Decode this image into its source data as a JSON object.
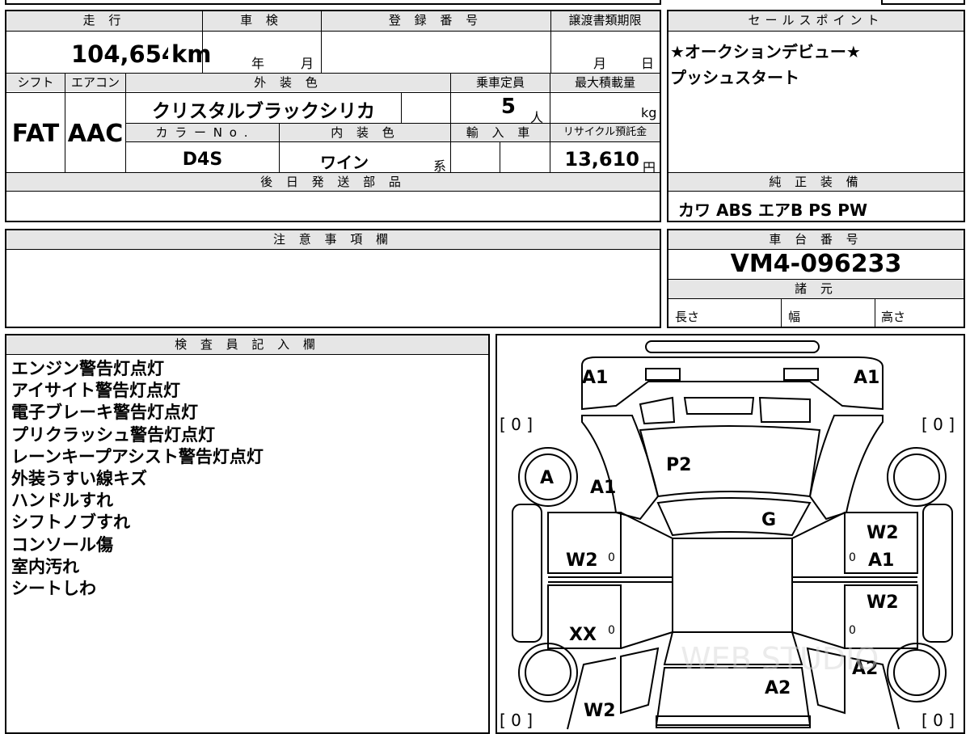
{
  "main": {
    "mileage": {
      "label": "走 行",
      "value": "104,654",
      "unit": "km"
    },
    "shaken": {
      "label": "車 検",
      "year_unit": "年",
      "month_unit": "月"
    },
    "registration": {
      "label": "登 録 番 号",
      "value": ""
    },
    "transfer_deadline": {
      "label": "譲渡書類期限",
      "month_unit": "月",
      "day_unit": "日"
    },
    "shift": {
      "label": "シフト",
      "value": "FAT"
    },
    "aircon": {
      "label": "エアコン",
      "value": "AAC"
    },
    "exterior_color": {
      "label": "外 装 色",
      "value": "クリスタルブラックシリカ"
    },
    "capacity": {
      "label": "乗車定員",
      "value": "5",
      "unit": "人"
    },
    "max_load": {
      "label": "最大積載量",
      "value": "",
      "unit": "kg"
    },
    "color_no": {
      "label": "カ ラ ー N o .",
      "value": "D4S"
    },
    "interior_color": {
      "label": "内 装 色",
      "value": "ワイン",
      "unit": "系"
    },
    "import": {
      "label": "輸 入 車"
    },
    "recycle": {
      "label": "リサイクル預託金",
      "value": "13,610",
      "unit": "円"
    },
    "parts_later": {
      "label": "後 日 発 送 部 品"
    }
  },
  "sales_point": {
    "label": "セールスポイント",
    "lines": [
      "★オークションデビュー★",
      "プッシュスタート"
    ]
  },
  "equipment": {
    "label": "純 正 装 備",
    "value": "カワ ABS エアB PS PW"
  },
  "notes": {
    "label": "注 意 事 項 欄"
  },
  "chassis": {
    "label": "車 台 番 号",
    "value": "VM4-096233"
  },
  "specs": {
    "label": "諸 元",
    "length": "長さ",
    "width": "幅",
    "height": "高さ"
  },
  "inspector": {
    "label": "検 査 員 記 入 欄",
    "lines": [
      "エンジン警告灯点灯",
      "アイサイト警告灯点灯",
      "電子ブレーキ警告灯点灯",
      "プリクラッシュ警告灯点灯",
      "レーンキープアシスト警告灯点灯",
      "外装うすい線キズ",
      "ハンドルすれ",
      "シフトノブすれ",
      "コンソール傷",
      "室内汚れ",
      "シートしわ"
    ]
  },
  "diagram": {
    "tl_a1": "A1",
    "tr_a1": "A1",
    "tire_fl": "[ 0 ]",
    "tire_fr": "[ 0 ]",
    "tire_rl": "[ 0 ]",
    "tire_rr": "[ 0 ]",
    "wheel_a": "A",
    "fender_a1": "A1",
    "windshield_p2": "P2",
    "roof_g": "G",
    "door_fr": "W2",
    "door_fr_a1": "A1",
    "door_rr": "W2",
    "door_fl": "W2",
    "door_rl": "XX",
    "quarter_r": "A2",
    "rear_a2": "A2",
    "quarter_l": "W2",
    "zero_fl": "0",
    "zero_rl": "0",
    "zero_fr": "0",
    "zero_rr": "0",
    "watermark": "WEB STUDIO"
  }
}
